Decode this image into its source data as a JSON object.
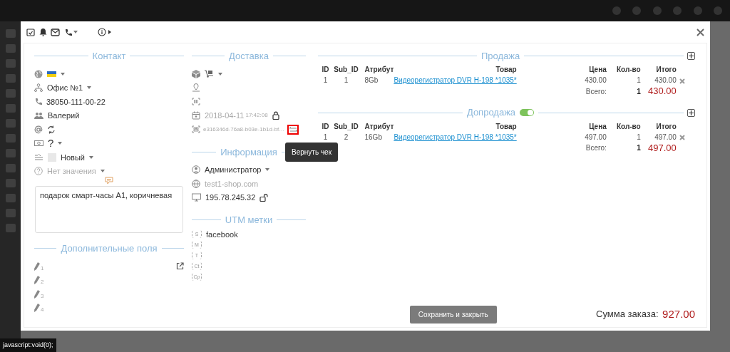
{
  "toolbar": {
    "items": [
      {
        "kind": "calendar"
      },
      {
        "kind": "bell"
      },
      {
        "kind": "mail"
      },
      {
        "kind": "phone_menu"
      },
      {
        "kind": "info_menu"
      }
    ]
  },
  "contact": {
    "title": "Контакт",
    "rows": [
      {
        "kind": "country"
      },
      {
        "kind": "office",
        "text": "Офис №1"
      },
      {
        "kind": "phone",
        "text": "38050-111-00-22"
      },
      {
        "kind": "name",
        "text": "Валерий"
      },
      {
        "kind": "email"
      },
      {
        "kind": "payment",
        "text": "?"
      },
      {
        "kind": "status",
        "text": "Новый"
      },
      {
        "kind": "source",
        "text": "Нет значения",
        "disabled": true
      }
    ],
    "comment": "подарок смарт-часы А1, коричневая"
  },
  "extra_fields": {
    "title": "Дополнительные поля",
    "items": [
      {
        "index": "1"
      },
      {
        "index": "2"
      },
      {
        "index": "3"
      },
      {
        "index": "4"
      }
    ]
  },
  "delivery": {
    "title": "Доставка",
    "date": "2018-04-11",
    "time": "17:42:08",
    "locked": true,
    "receipt": "e316346d-76a8-b03e-1b1d-bf…",
    "tooltip": "Вернуть чек"
  },
  "information": {
    "title": "Информация",
    "manager": "Администратор",
    "site": "test1-shop.com",
    "ip": "195.78.245.32"
  },
  "utm": {
    "title": "UTM метки",
    "items": [
      {
        "tag": "S",
        "value": "facebook"
      },
      {
        "tag": "M"
      },
      {
        "tag": "T"
      },
      {
        "tag": "Ct"
      },
      {
        "tag": "Cp"
      }
    ]
  },
  "sale": {
    "title": "Продажа",
    "columns": [
      "ID",
      "Sub_ID",
      "Атрибут",
      "Товар",
      "Цена",
      "Кол-во",
      "Итого"
    ],
    "rows": [
      {
        "id": "1",
        "sub_id": "1",
        "attribute": "8Gb",
        "product": "Видеорегистратор DVR H-198 *1035*",
        "price": "430.00",
        "qty": "1",
        "total": "430.00"
      }
    ],
    "total_label": "Всего:",
    "total_qty": "1",
    "total_sum": "430.00"
  },
  "upsale": {
    "title": "Допродажа",
    "on": true,
    "columns": [
      "ID",
      "Sub_ID",
      "Атрибут",
      "Товар",
      "Цена",
      "Кол-во",
      "Итого"
    ],
    "rows": [
      {
        "id": "1",
        "sub_id": "2",
        "attribute": "16Gb",
        "product": "Видеорегистратор DVR H-198 *1035*",
        "price": "497.00",
        "qty": "1",
        "total": "497.00"
      }
    ],
    "total_label": "Всего:",
    "total_qty": "1",
    "total_sum": "497.00"
  },
  "save_button": "Сохранить и закрыть",
  "order_sum": {
    "label": "Сумма заказа:",
    "value": "927.00"
  },
  "status_bar": "javascript:void(0);"
}
